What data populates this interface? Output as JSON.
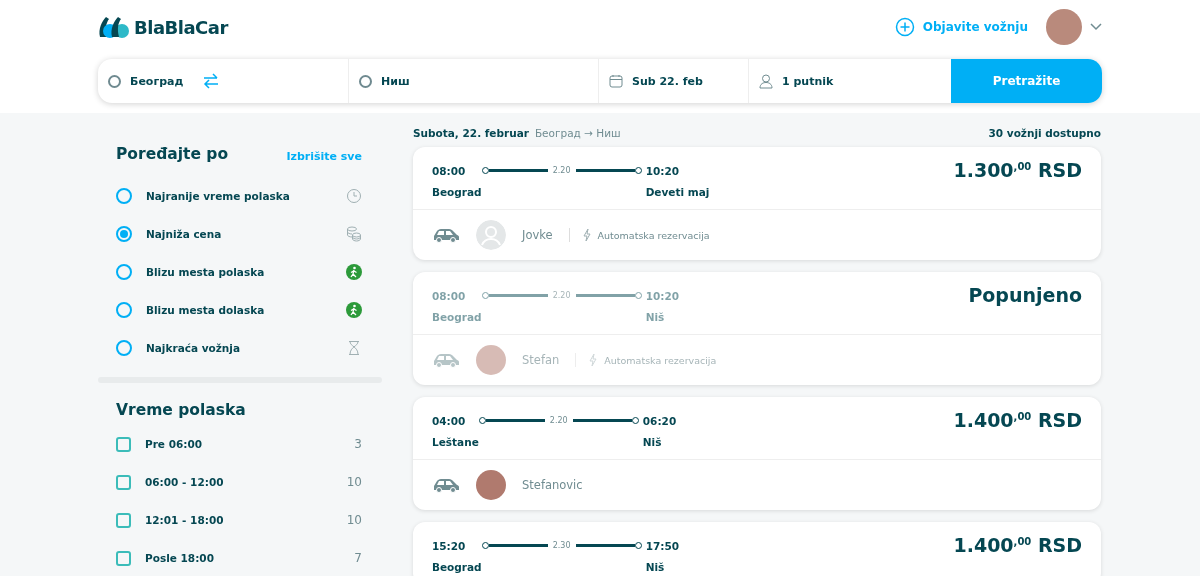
{
  "header": {
    "logo": "BlaBlaCar",
    "publish_link": "Objavite vožnju"
  },
  "search": {
    "from": "Београд",
    "to": "Ниш",
    "date": "Sub 22. feb",
    "passengers": "1 putnik",
    "button": "Pretražite"
  },
  "sort": {
    "title": "Poređajte po",
    "clear": "Izbrišite sve",
    "options": [
      {
        "label": "Najranije vreme polaska",
        "selected": false
      },
      {
        "label": "Najniža cena",
        "selected": true
      },
      {
        "label": "Blizu mesta polaska",
        "selected": false
      },
      {
        "label": "Blizu mesta dolaska",
        "selected": false
      },
      {
        "label": "Najkraća vožnja",
        "selected": false
      }
    ]
  },
  "departure_time": {
    "title": "Vreme polaska",
    "options": [
      {
        "label": "Pre 06:00",
        "count": "3",
        "checked": false
      },
      {
        "label": "06:00 - 12:00",
        "count": "10",
        "checked": false
      },
      {
        "label": "12:01 - 18:00",
        "count": "10",
        "checked": false
      },
      {
        "label": "Posle 18:00",
        "count": "7",
        "checked": false
      }
    ]
  },
  "results": {
    "date": "Subota, 22. februar",
    "route": "Београд → Ниш",
    "count": "30 vožnji dostupno",
    "trips": [
      {
        "full": false,
        "depart": "08:00",
        "duration": "2.20",
        "arrive": "10:20",
        "from": "Beograd",
        "to": "Deveti maj",
        "price": "1.300$^{,00}$ RSD",
        "has_photo": false,
        "driver": "Jovke",
        "booking": "Automatska rezervacija"
      },
      {
        "full": true,
        "depart": "08:00",
        "duration": "2.20",
        "arrive": "10:20",
        "from": "Beograd",
        "to": "Niš",
        "price": "Popunjeno",
        "has_photo": true,
        "driver": "Stefan",
        "booking": "Automatska rezervacija"
      },
      {
        "full": false,
        "depart": "04:00",
        "duration": "2.20",
        "arrive": "06:20",
        "from": "Leštane",
        "to": "Niš",
        "price": "1.400$^{,00}$ RSD",
        "has_photo": true,
        "driver": "Stefanovic"
      },
      {
        "full": false,
        "depart": "15:20",
        "duration": "2.30",
        "arrive": "17:50",
        "from": "Beograd",
        "to": "Niš",
        "price": "1.400$^{,00}$ RSD"
      }
    ]
  }
}
